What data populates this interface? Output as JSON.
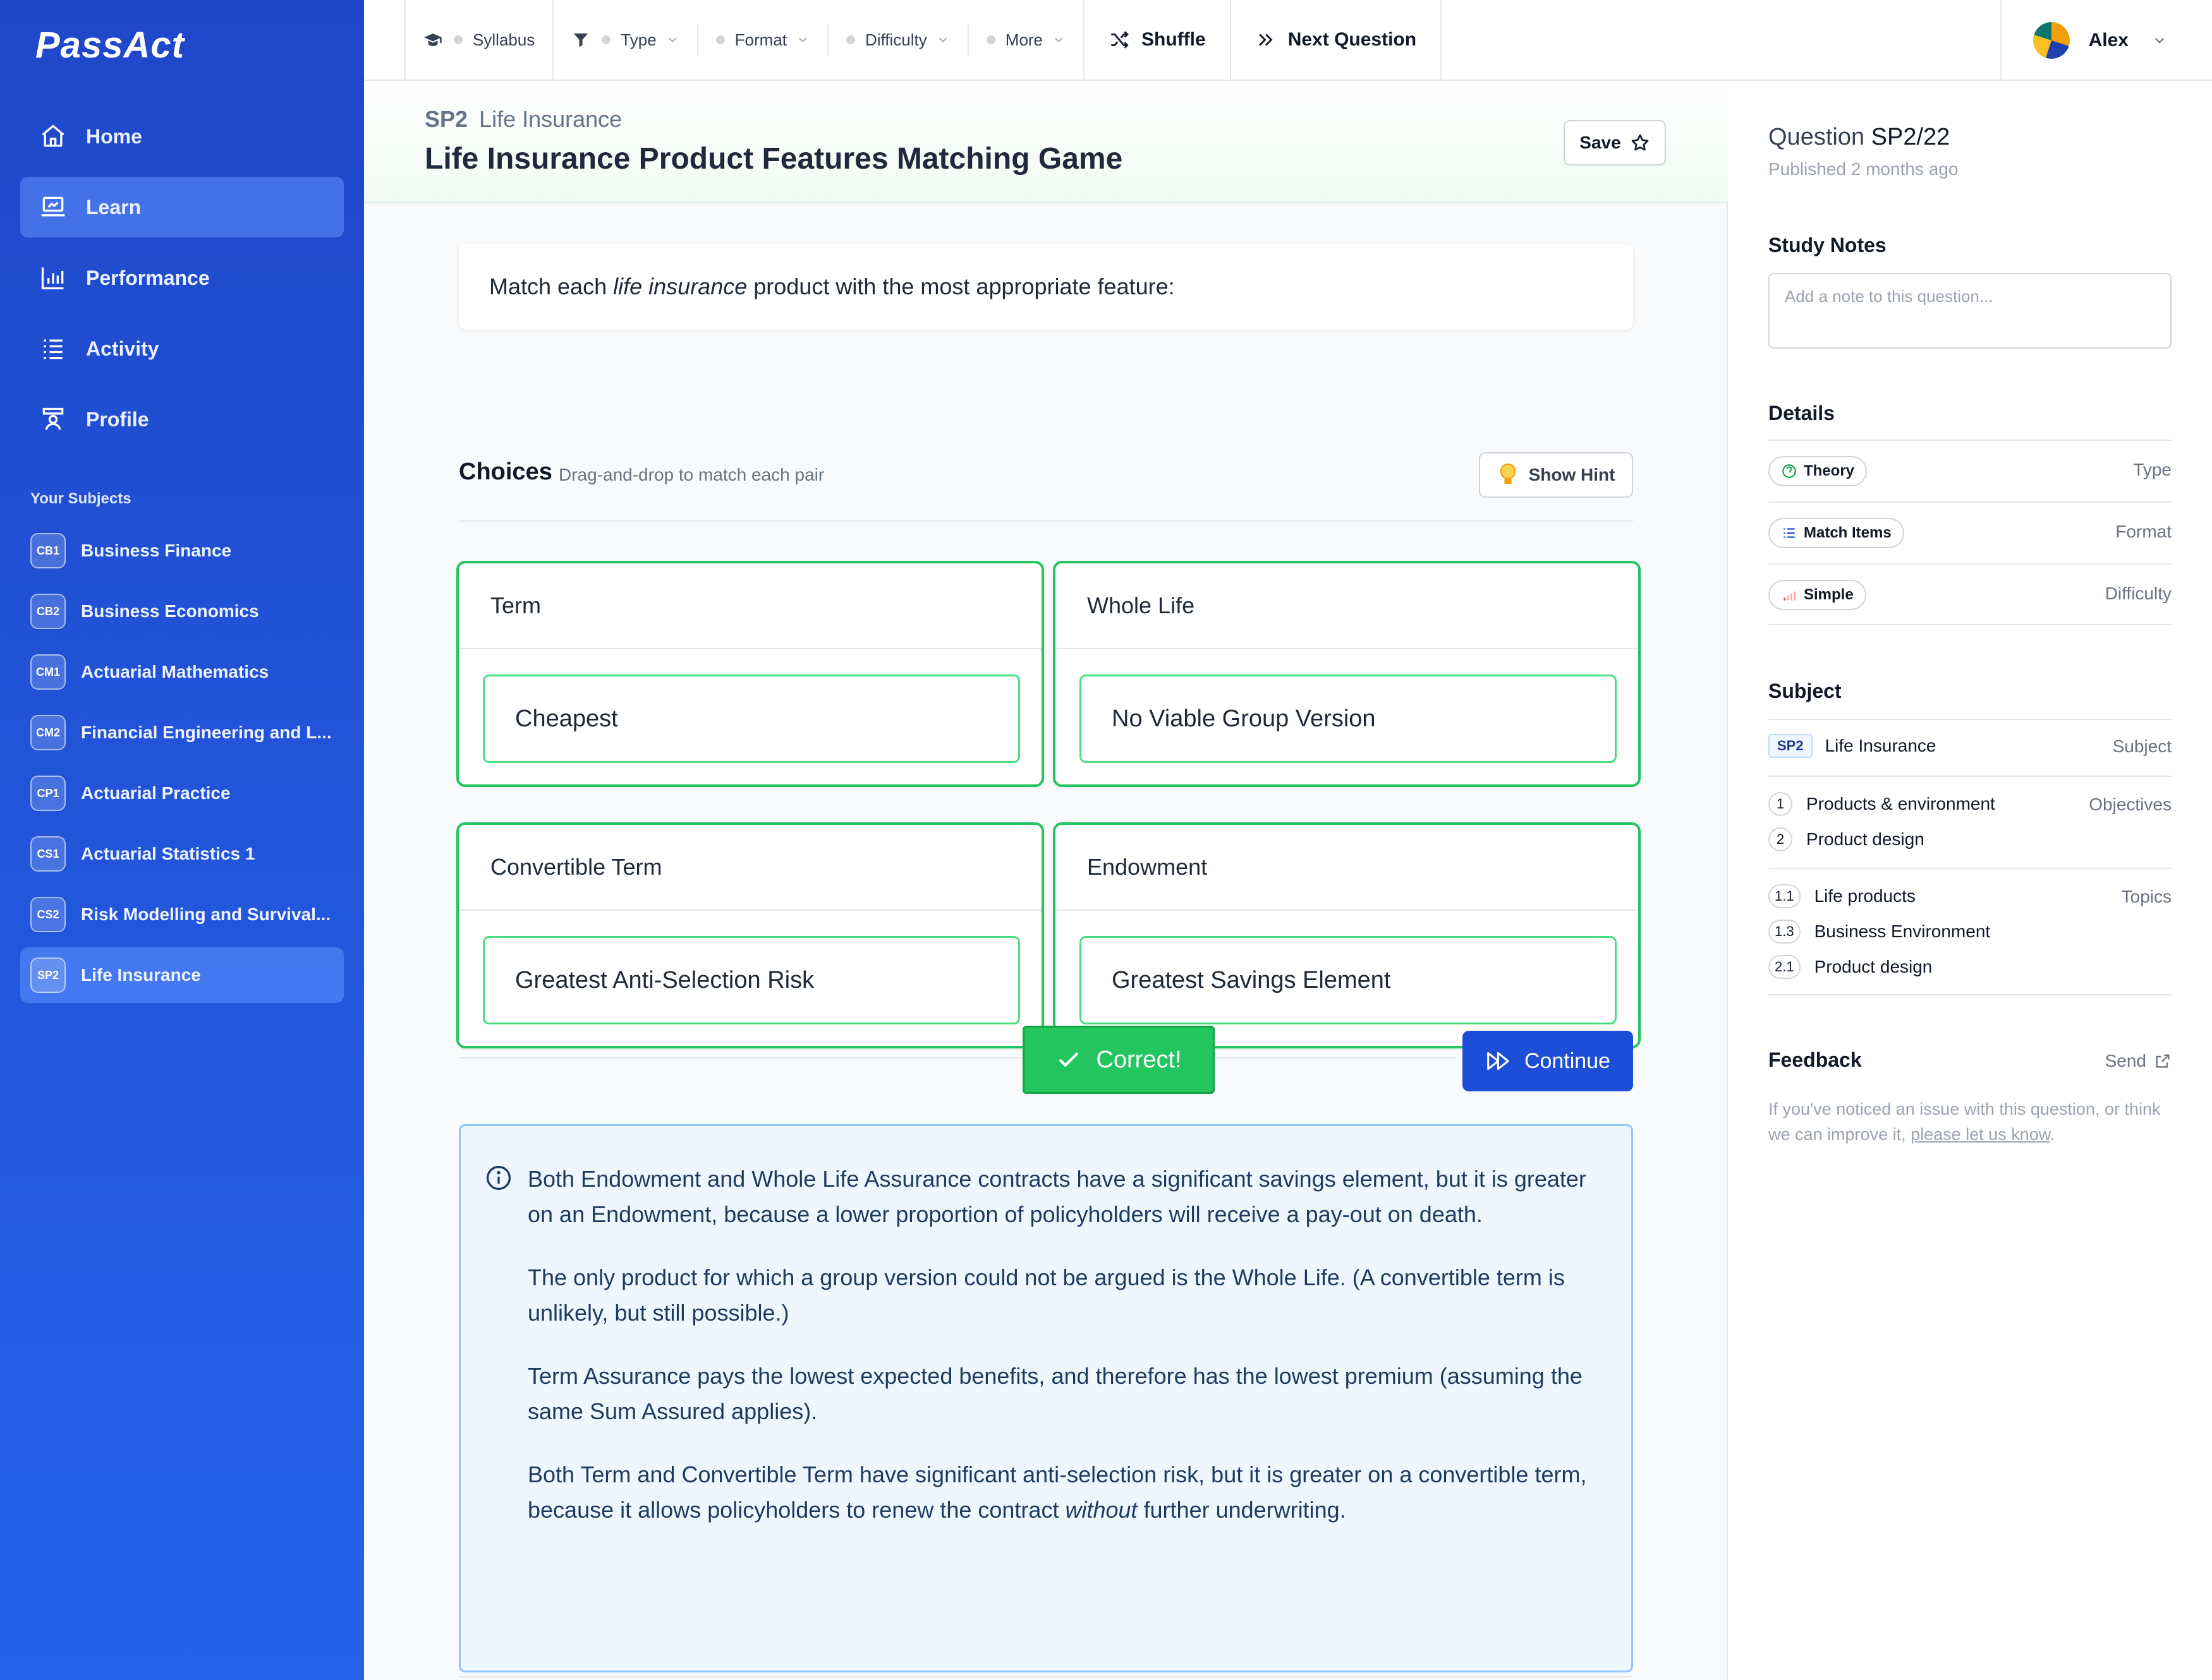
{
  "app": {
    "logo": "PassAct"
  },
  "sidebar": {
    "nav": [
      {
        "label": "Home",
        "icon": "home-icon",
        "active": false
      },
      {
        "label": "Learn",
        "icon": "laptop-icon",
        "active": true
      },
      {
        "label": "Performance",
        "icon": "bar-chart-icon",
        "active": false
      },
      {
        "label": "Activity",
        "icon": "list-icon",
        "active": false
      },
      {
        "label": "Profile",
        "icon": "profile-icon",
        "active": false
      }
    ],
    "subjects_title": "Your Subjects",
    "subjects": [
      {
        "code": "CB1",
        "label": "Business Finance"
      },
      {
        "code": "CB2",
        "label": "Business Economics"
      },
      {
        "code": "CM1",
        "label": "Actuarial Mathematics"
      },
      {
        "code": "CM2",
        "label": "Financial Engineering and L..."
      },
      {
        "code": "CP1",
        "label": "Actuarial Practice"
      },
      {
        "code": "CS1",
        "label": "Actuarial Statistics 1"
      },
      {
        "code": "CS2",
        "label": "Risk Modelling and Survival..."
      },
      {
        "code": "SP2",
        "label": "Life Insurance"
      }
    ]
  },
  "topbar": {
    "syllabus": "Syllabus",
    "type": "Type",
    "format": "Format",
    "difficulty": "Difficulty",
    "more": "More",
    "shuffle": "Shuffle",
    "next": "Next Question",
    "user": "Alex"
  },
  "header": {
    "code": "SP2",
    "subject": "Life Insurance",
    "title": "Life Insurance Product Features Matching Game",
    "save": "Save"
  },
  "question": {
    "prompt_before": "Match each ",
    "prompt_em": "life insurance",
    "prompt_after": " product with the most appropriate feature:",
    "choices_title": "Choices",
    "choices_sub": "Drag-and-drop to match each pair",
    "hint": "Show Hint",
    "pairs": [
      {
        "product": "Term",
        "feature": "Cheapest"
      },
      {
        "product": "Whole Life",
        "feature": "No Viable Group Version"
      },
      {
        "product": "Convertible Term",
        "feature": "Greatest Anti-Selection Risk"
      },
      {
        "product": "Endowment",
        "feature": "Greatest Savings Element"
      }
    ],
    "result": "Correct!",
    "continue": "Continue"
  },
  "explanation": {
    "p1": "Both Endowment and Whole Life Assurance contracts have a significant savings element, but it is greater on an Endowment, because a lower proportion of policyholders will receive a pay-out on death.",
    "p2": "The only product for which a group version could not be argued is the Whole Life. (A convertible term is unlikely, but still possible.)",
    "p3": "Term Assurance pays the lowest expected benefits, and therefore has the lowest premium (assuming the same Sum Assured applies).",
    "p4_before": "Both Term and Convertible Term have significant anti-selection risk, but it is greater on a convertible term, because it allows policyholders to renew the contract ",
    "p4_em": "without",
    "p4_after": " further underwriting."
  },
  "panel": {
    "question_label": "Question",
    "question_id": "SP2/22",
    "published": "Published 2 months ago",
    "notes_title": "Study Notes",
    "notes_placeholder": "Add a note to this question...",
    "details_title": "Details",
    "details": [
      {
        "value": "Theory",
        "label": "Type",
        "icon": "theory-icon"
      },
      {
        "value": "Match Items",
        "label": "Format",
        "icon": "list-icon"
      },
      {
        "value": "Simple",
        "label": "Difficulty",
        "icon": "signal-icon"
      }
    ],
    "subject_title": "Subject",
    "subject_code": "SP2",
    "subject_name": "Life Insurance",
    "subject_label": "Subject",
    "objectives_label": "Objectives",
    "objectives": [
      {
        "num": "1",
        "label": "Products & environment"
      },
      {
        "num": "2",
        "label": "Product design"
      }
    ],
    "topics_label": "Topics",
    "topics": [
      {
        "num": "1.1",
        "label": "Life products"
      },
      {
        "num": "1.3",
        "label": "Business Environment"
      },
      {
        "num": "2.1",
        "label": "Product design"
      }
    ],
    "feedback_title": "Feedback",
    "feedback_send": "Send",
    "feedback_text": "If you've noticed an issue with this question, or think we can improve it, ",
    "feedback_link": "please let us know",
    "feedback_end": "."
  },
  "colors": {
    "sidebar": "#1f47c9",
    "accent": "#1d4ed8",
    "success": "#22c55e",
    "info_bg": "#eef6fe"
  }
}
